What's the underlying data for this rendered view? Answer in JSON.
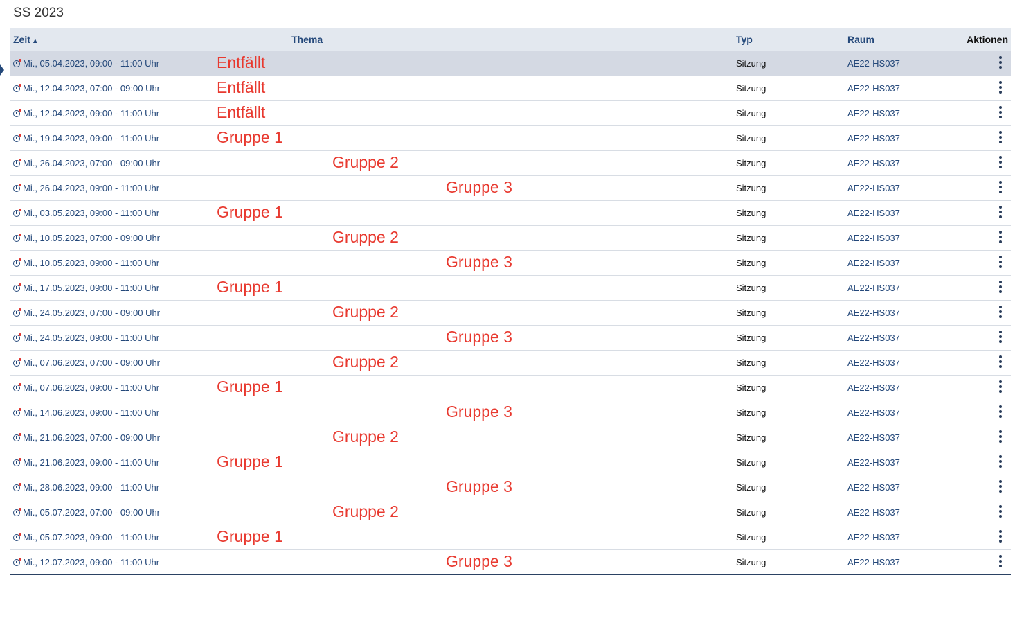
{
  "semester": "SS 2023",
  "columns": {
    "zeit": "Zeit",
    "thema": "Thema",
    "typ": "Typ",
    "raum": "Raum",
    "aktionen": "Aktionen"
  },
  "sort_indicator": "▲",
  "icons": {
    "row_icon": "clock-icon",
    "action_icon": "vertical-dots-icon",
    "selection": "triangle-pointer-icon"
  },
  "colors": {
    "accent": "#24487a",
    "annotation": "#e8392f",
    "selected_row": "#d4d9e3",
    "header_bg": "#e3e8ef"
  },
  "rows": [
    {
      "time": "Mi., 05.04.2023, 09:00 - 11:00 Uhr",
      "thema": "Entfällt",
      "typ": "Sitzung",
      "raum": "AE22-HS037",
      "selected": true
    },
    {
      "time": "Mi., 12.04.2023, 07:00 - 09:00 Uhr",
      "thema": "Entfällt",
      "typ": "Sitzung",
      "raum": "AE22-HS037"
    },
    {
      "time": "Mi., 12.04.2023, 09:00 - 11:00 Uhr",
      "thema": "Entfällt",
      "typ": "Sitzung",
      "raum": "AE22-HS037"
    },
    {
      "time": "Mi., 19.04.2023, 09:00 - 11:00 Uhr",
      "thema": "Gruppe 1",
      "typ": "Sitzung",
      "raum": "AE22-HS037"
    },
    {
      "time": "Mi., 26.04.2023, 07:00 - 09:00 Uhr",
      "thema": "Gruppe 2",
      "typ": "Sitzung",
      "raum": "AE22-HS037"
    },
    {
      "time": "Mi., 26.04.2023, 09:00 - 11:00 Uhr",
      "thema": "Gruppe 3",
      "typ": "Sitzung",
      "raum": "AE22-HS037"
    },
    {
      "time": "Mi., 03.05.2023, 09:00 - 11:00 Uhr",
      "thema": "Gruppe 1",
      "typ": "Sitzung",
      "raum": "AE22-HS037"
    },
    {
      "time": "Mi., 10.05.2023, 07:00 - 09:00 Uhr",
      "thema": "Gruppe 2",
      "typ": "Sitzung",
      "raum": "AE22-HS037"
    },
    {
      "time": "Mi., 10.05.2023, 09:00 - 11:00 Uhr",
      "thema": "Gruppe 3",
      "typ": "Sitzung",
      "raum": "AE22-HS037"
    },
    {
      "time": "Mi., 17.05.2023, 09:00 - 11:00 Uhr",
      "thema": "Gruppe 1",
      "typ": "Sitzung",
      "raum": "AE22-HS037"
    },
    {
      "time": "Mi., 24.05.2023, 07:00 - 09:00 Uhr",
      "thema": "Gruppe 2",
      "typ": "Sitzung",
      "raum": "AE22-HS037"
    },
    {
      "time": "Mi., 24.05.2023, 09:00 - 11:00 Uhr",
      "thema": "Gruppe 3",
      "typ": "Sitzung",
      "raum": "AE22-HS037"
    },
    {
      "time": "Mi., 07.06.2023, 07:00 - 09:00 Uhr",
      "thema": "Gruppe 2",
      "typ": "Sitzung",
      "raum": "AE22-HS037"
    },
    {
      "time": "Mi., 07.06.2023, 09:00 - 11:00 Uhr",
      "thema": "Gruppe 1",
      "typ": "Sitzung",
      "raum": "AE22-HS037"
    },
    {
      "time": "Mi., 14.06.2023, 09:00 - 11:00 Uhr",
      "thema": "Gruppe 3",
      "typ": "Sitzung",
      "raum": "AE22-HS037"
    },
    {
      "time": "Mi., 21.06.2023, 07:00 - 09:00 Uhr",
      "thema": "Gruppe 2",
      "typ": "Sitzung",
      "raum": "AE22-HS037"
    },
    {
      "time": "Mi., 21.06.2023, 09:00 - 11:00 Uhr",
      "thema": "Gruppe 1",
      "typ": "Sitzung",
      "raum": "AE22-HS037"
    },
    {
      "time": "Mi., 28.06.2023, 09:00 - 11:00 Uhr",
      "thema": "Gruppe 3",
      "typ": "Sitzung",
      "raum": "AE22-HS037"
    },
    {
      "time": "Mi., 05.07.2023, 07:00 - 09:00 Uhr",
      "thema": "Gruppe 2",
      "typ": "Sitzung",
      "raum": "AE22-HS037"
    },
    {
      "time": "Mi., 05.07.2023, 09:00 - 11:00 Uhr",
      "thema": "Gruppe 1",
      "typ": "Sitzung",
      "raum": "AE22-HS037"
    },
    {
      "time": "Mi., 12.07.2023, 09:00 - 11:00 Uhr",
      "thema": "Gruppe 3",
      "typ": "Sitzung",
      "raum": "AE22-HS037"
    }
  ]
}
